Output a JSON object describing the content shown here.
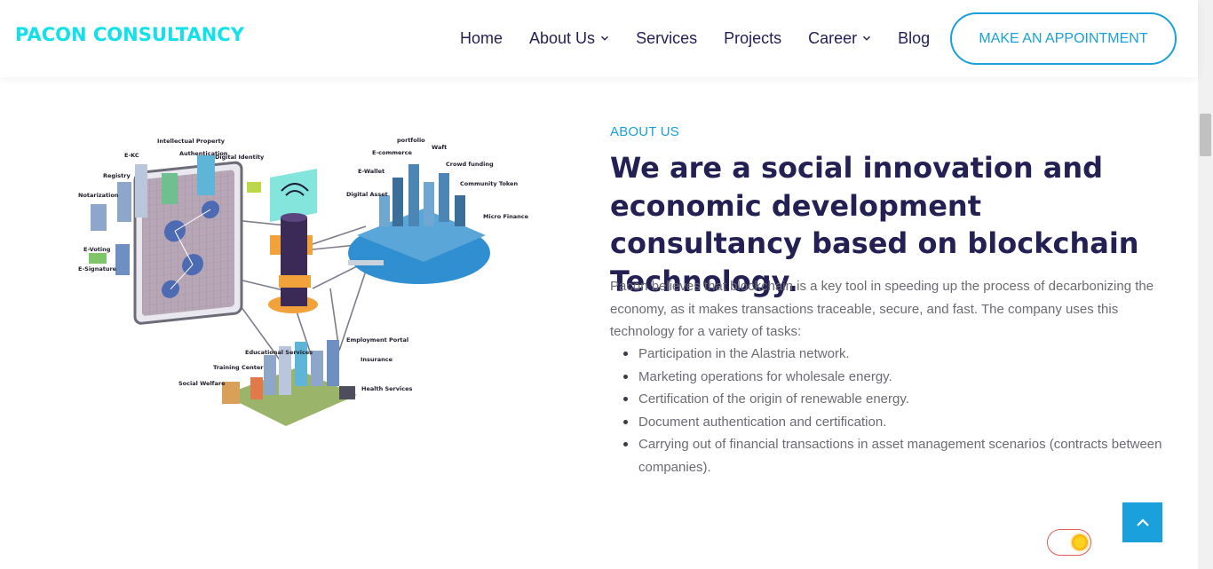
{
  "brand": {
    "name": "PACON CONSULTANCY",
    "color": "#12e0ea"
  },
  "nav": {
    "items": [
      {
        "label": "Home",
        "dropdown": false
      },
      {
        "label": "About Us",
        "dropdown": true
      },
      {
        "label": "Services",
        "dropdown": false
      },
      {
        "label": "Projects",
        "dropdown": false
      },
      {
        "label": "Career",
        "dropdown": true
      },
      {
        "label": "Blog",
        "dropdown": false
      }
    ],
    "cta_label": "MAKE AN APPOINTMENT"
  },
  "about": {
    "label": "ABOUT US",
    "headline": "We are a social innovation and economic development consultancy based on blockchain Technology.",
    "intro": "Pacon believes that blockchain is a key tool in speeding up the process of decarbonizing the economy, as it makes transactions traceable, secure, and fast. The company uses this technology for a variety of tasks:",
    "tasks": [
      "Participation in the Alastria network.",
      "Marketing operations for wholesale energy.",
      "Certification of the origin of renewable energy.",
      "Document authentication and certification.",
      "Carrying out of financial transactions in asset management scenarios (contracts between companies)."
    ]
  },
  "illustration": {
    "left_labels": [
      "Intellectual Property",
      "Authentication",
      "Digital Identity",
      "E-KC",
      "Registry",
      "Notarization",
      "E-Voting",
      "E-Signature"
    ],
    "right_labels": [
      "portfolio",
      "Waft",
      "E-commerce",
      "Crowd funding",
      "E-Wallet",
      "Community Token",
      "Digital Asset",
      "Micro Finance"
    ],
    "bottom_labels": [
      "Employment Portal",
      "Educational Services",
      "Insurance",
      "Training Center",
      "Social Welfare",
      "Health Services"
    ]
  },
  "colors": {
    "accent": "#1aa0db",
    "heading": "#232154",
    "body_text": "#6b6b73"
  },
  "icons": {
    "theme_toggle": "sun-icon",
    "back_to_top": "chevron-up-icon",
    "nav_dropdown": "chevron-down-icon"
  }
}
